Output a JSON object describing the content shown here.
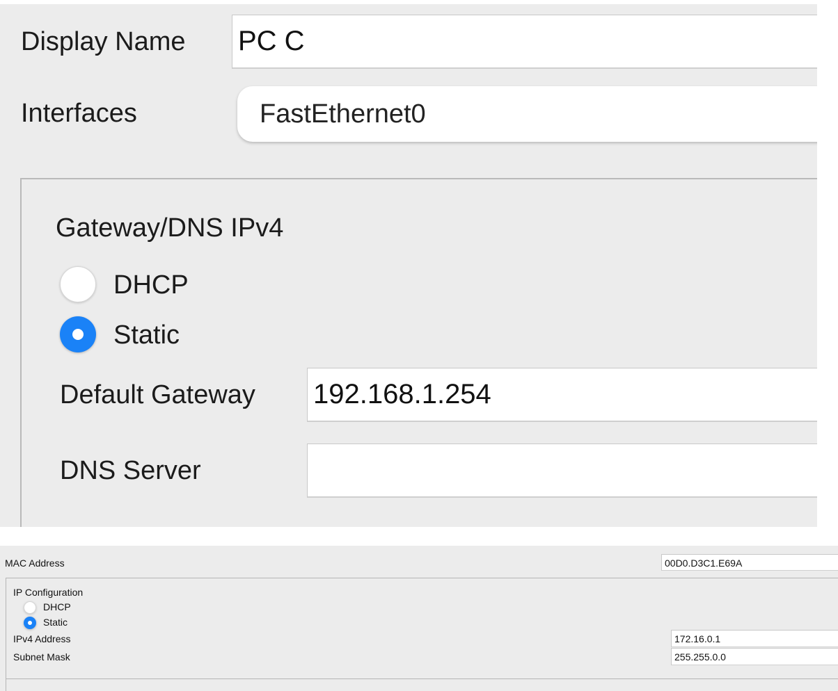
{
  "top_panel": {
    "display_name_label": "Display Name",
    "display_name_value": "PC C",
    "interfaces_label": "Interfaces",
    "interfaces_value": "FastEthernet0",
    "gateway_dns": {
      "section_title": "Gateway/DNS IPv4",
      "dhcp_label": "DHCP",
      "static_label": "Static",
      "selected_mode": "Static",
      "default_gateway_label": "Default Gateway",
      "default_gateway_value": "192.168.1.254",
      "dns_server_label": "DNS Server",
      "dns_server_value": ""
    }
  },
  "bottom_panel": {
    "mac_address_label": "MAC Address",
    "mac_address_value": "00D0.D3C1.E69A",
    "ip_config": {
      "section_title": "IP Configuration",
      "dhcp_label": "DHCP",
      "static_label": "Static",
      "selected_mode": "Static",
      "ipv4_address_label": "IPv4 Address",
      "ipv4_address_value": "172.16.0.1",
      "subnet_mask_label": "Subnet Mask",
      "subnet_mask_value": "255.255.0.0"
    }
  },
  "colors": {
    "panel_background": "#ececec",
    "radio_selected": "#1a82f7",
    "field_background": "#ffffff"
  }
}
